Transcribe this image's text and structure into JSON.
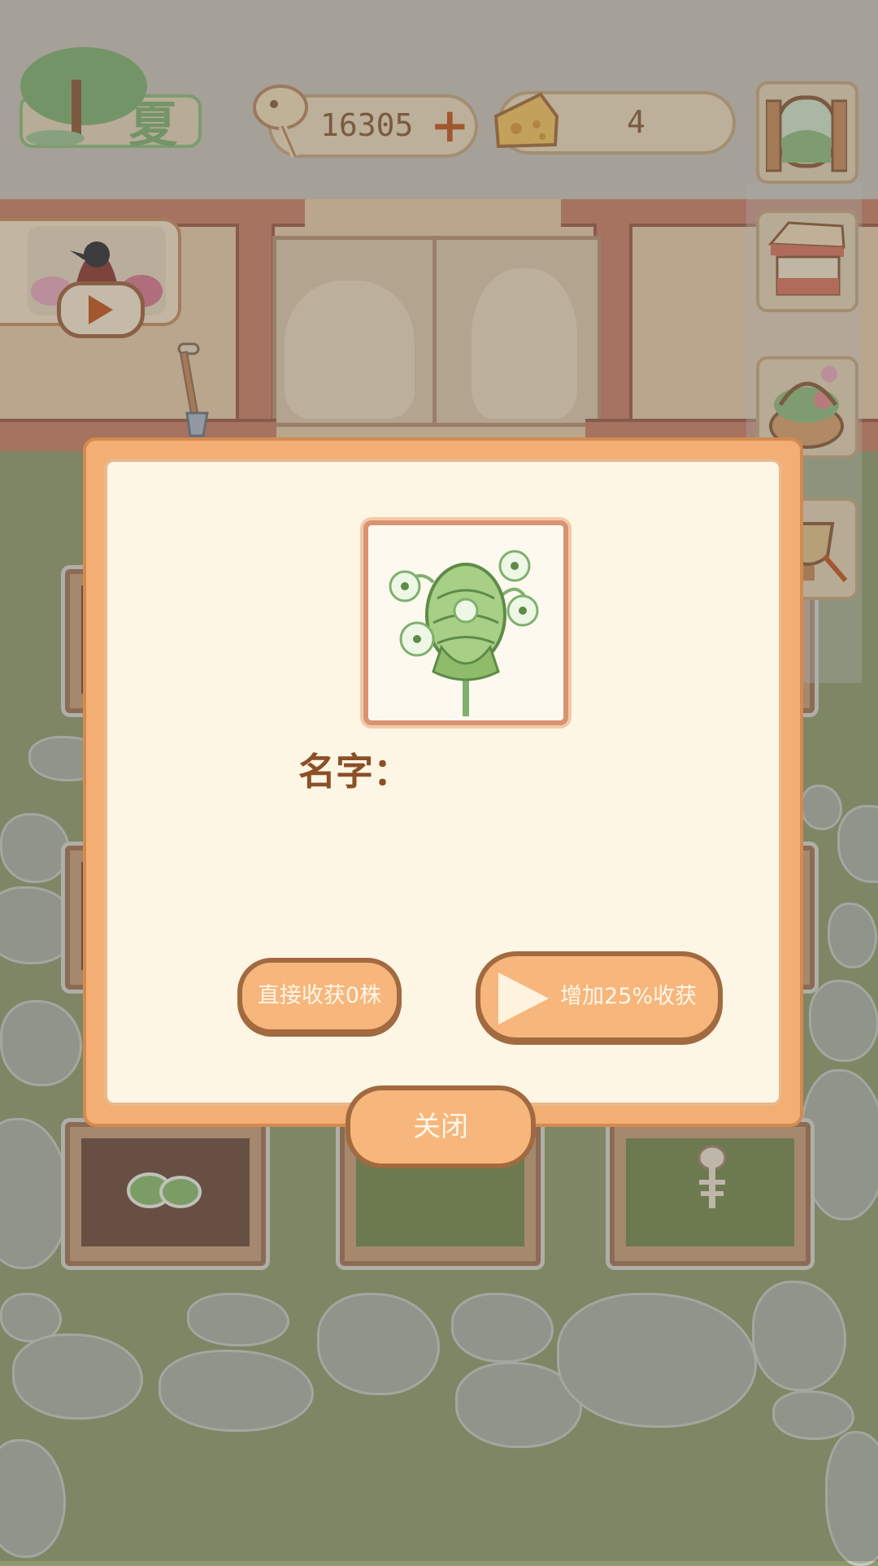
{
  "hud": {
    "season_label": "夏",
    "fish_bones_count": "16305",
    "cheese_count": "4",
    "add_symbol": "+"
  },
  "modal": {
    "name_label": "名字：",
    "harvest_button": "直接收获0株",
    "ad_harvest_button": "增加25%收获",
    "close_button": "关闭"
  },
  "colors": {
    "accent": "#f7b67b",
    "border_brown": "#a26a40",
    "panel_bg": "#fdf6e4",
    "lawn": "#8f9b6b"
  },
  "icons": {
    "season": "tree-icon",
    "currency_fish": "fishbone-icon",
    "currency_cheese": "cheese-icon",
    "side_1": "window-icon",
    "side_2": "shop-stall-icon",
    "side_3": "flower-basket-icon",
    "side_4": "trophy-icon",
    "play": "play-icon",
    "plant": "artichoke-flower-icon"
  }
}
